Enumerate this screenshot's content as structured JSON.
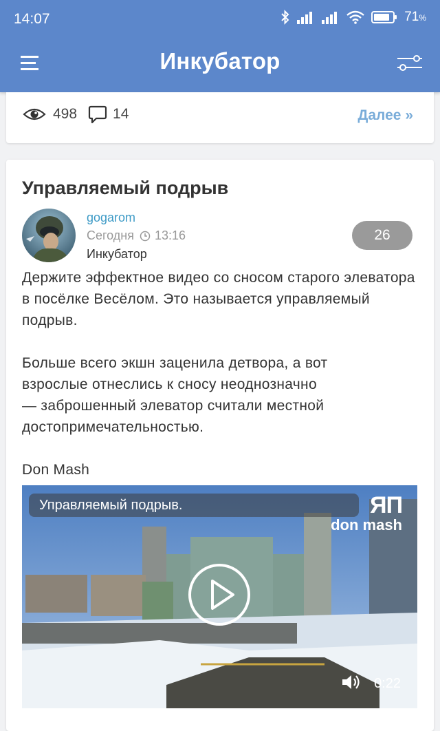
{
  "status_bar": {
    "time": "14:07",
    "battery_pct": "71",
    "battery_unit": "%"
  },
  "toolbar": {
    "title": "Инкубатор"
  },
  "prev_post": {
    "views": "498",
    "comments": "14",
    "more_label": "Далее »"
  },
  "post": {
    "title": "Управляемый подрыв",
    "author": "gogarom",
    "date_label": "Сегодня",
    "time": "13:16",
    "section": "Инкубатор",
    "rating": "26",
    "paragraph1": "Держите эффектное видео со сносом старого элеватора в посёлке Весёлом. Это называется управляемый подрыв.",
    "paragraph2_line1": "Больше всего экшн заценила детвора, а вот",
    "paragraph2_line2": "взрослые отнеслись к сносу неоднозначно",
    "paragraph2_line3": "— заброшенный элеватор считали местной",
    "paragraph2_line4": "достопримечательностью.",
    "source": "Don Mash"
  },
  "video": {
    "title": "Управляемый подрыв.",
    "duration": "0:22",
    "watermark_logo": "ЯП",
    "watermark_text": "don mash"
  }
}
